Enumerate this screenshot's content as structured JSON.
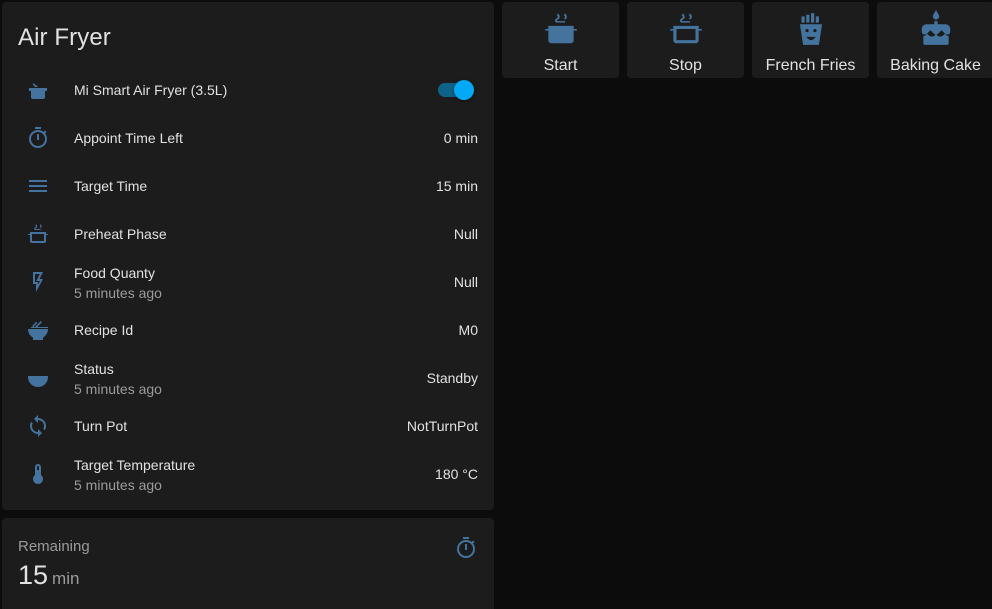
{
  "entities_card": {
    "title": "Air Fryer",
    "rows": [
      {
        "icon": "pot-icon",
        "name": "Mi Smart Air Fryer (3.5L)",
        "toggle_on": true
      },
      {
        "icon": "timer-icon",
        "name": "Appoint Time Left",
        "state": "0 min"
      },
      {
        "icon": "menu-icon",
        "name": "Target Time",
        "state": "15 min"
      },
      {
        "icon": "pot-steam-outline-icon",
        "name": "Preheat Phase",
        "state": "Null"
      },
      {
        "icon": "flash-outline-icon",
        "name": "Food Quanty",
        "secondary": "5 minutes ago",
        "state": "Null"
      },
      {
        "icon": "noodles-icon",
        "name": "Recipe Id",
        "state": "M0"
      },
      {
        "icon": "bowl-icon",
        "name": "Status",
        "secondary": "5 minutes ago",
        "state": "Standby"
      },
      {
        "icon": "sync-icon",
        "name": "Turn Pot",
        "state": "NotTurnPot"
      },
      {
        "icon": "thermometer-icon",
        "name": "Target Temperature",
        "secondary": "5 minutes ago",
        "state": "180 °C"
      }
    ]
  },
  "sensor_card": {
    "name": "Remaining",
    "value": "15",
    "unit": "min",
    "icon": "timer-icon"
  },
  "buttons": [
    {
      "label": "Start",
      "icon": "pot-steam-icon"
    },
    {
      "label": "Stop",
      "icon": "pot-steam-outline-icon"
    },
    {
      "label": "French Fries",
      "icon": "french-fries-icon"
    },
    {
      "label": "Baking Cake",
      "icon": "cake-icon"
    }
  ],
  "colors": {
    "icon": "#44739e",
    "accent": "#03a9f4",
    "card_bg": "#1c1c1c",
    "page_bg": "#0c0c0c",
    "primary_text": "#e1e1e1",
    "secondary_text": "#9b9b9b"
  }
}
